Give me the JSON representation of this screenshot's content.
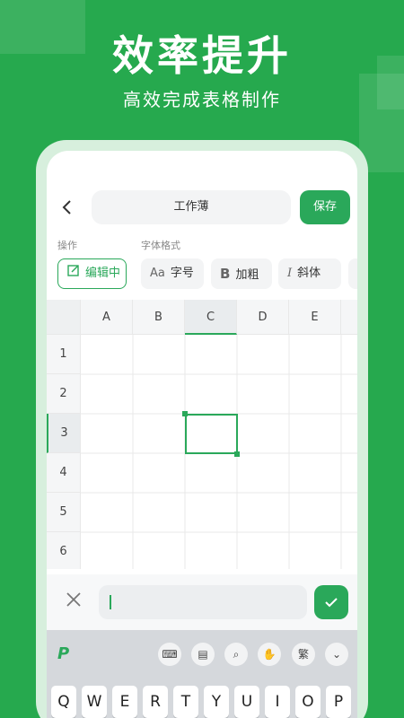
{
  "hero": {
    "title": "效率提升",
    "subtitle": "高效完成表格制作"
  },
  "header": {
    "title": "工作薄",
    "save_label": "保存",
    "back_icon": "chevron-left-icon"
  },
  "toolbar": {
    "section_operation": "操作",
    "section_font": "字体格式",
    "edit_label": "编辑中",
    "font_size_label": "字号",
    "bold_label": "加粗",
    "italic_label": "斜体"
  },
  "sheet": {
    "columns": [
      "A",
      "B",
      "C",
      "D",
      "E"
    ],
    "rows": [
      "1",
      "2",
      "3",
      "4",
      "5",
      "6"
    ],
    "selected_column": "C",
    "selected_row": "3"
  },
  "input": {
    "value": ""
  },
  "keyboard": {
    "keys_row1": [
      "Q",
      "W",
      "E",
      "R",
      "T",
      "Y",
      "U",
      "I",
      "O",
      "P"
    ],
    "traditional_label": "繁"
  },
  "colors": {
    "accent": "#2aa85a",
    "background": "#26a94e"
  }
}
